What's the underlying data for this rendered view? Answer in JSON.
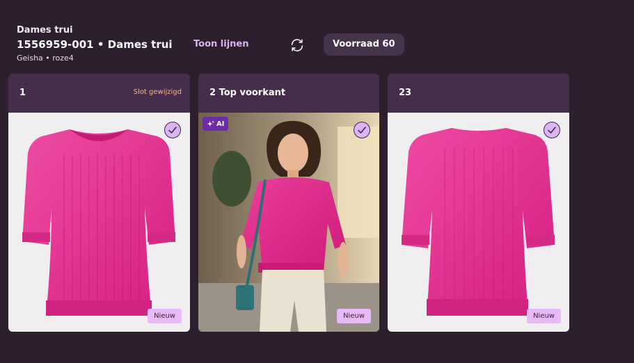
{
  "header": {
    "category": "Dames trui",
    "product_line": "1556959-001 • Dames trui",
    "subtitle": "Geisha • roze4",
    "toon_lijnen": "Toon lijnen",
    "voorraad": "Voorraad 60"
  },
  "slots": [
    {
      "title": "1",
      "changed_label": "Slot gewijzigd",
      "badge": "Nieuw",
      "checked": true,
      "image_icon": "sweater-front-image"
    },
    {
      "title": "2 Top voorkant",
      "ai_label": "AI",
      "badge": "Nieuw",
      "checked": true,
      "image_icon": "model-photo-image"
    },
    {
      "title": "23",
      "badge": "Nieuw",
      "checked": true,
      "image_icon": "sweater-back-image"
    }
  ],
  "colors": {
    "background": "#2d1f2e",
    "card_header": "#472d4c",
    "accent": "#dcb2f0",
    "badge": "#e7b9f6",
    "ai_badge": "#6d2ca7",
    "changed": "#f3b88f",
    "garment": "#e42d8c"
  }
}
